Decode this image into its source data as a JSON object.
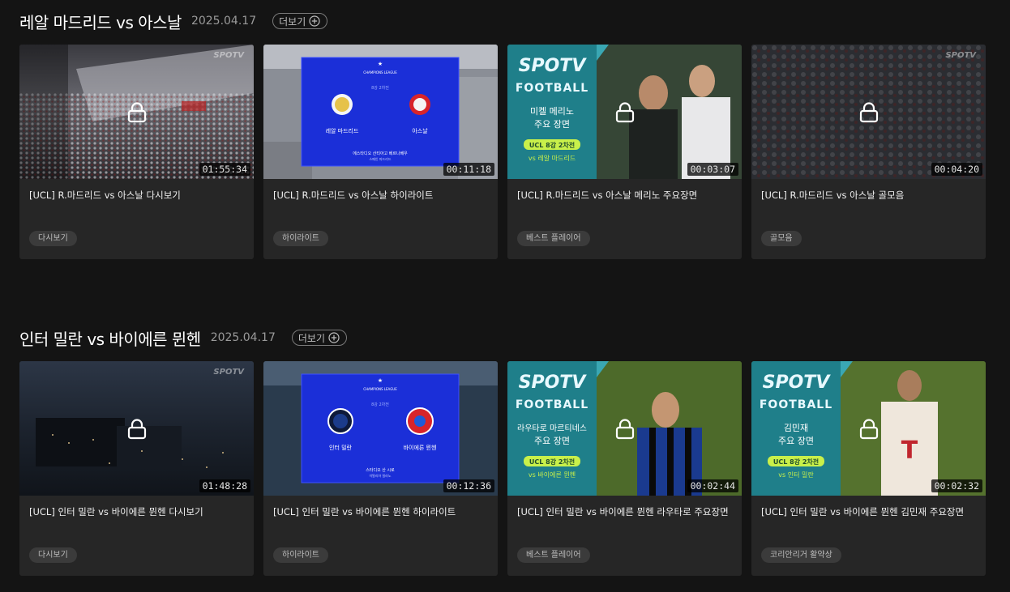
{
  "sections": [
    {
      "title": "레알 마드리드 vs 아스날",
      "date": "2025.04.17",
      "more_label": "더보기",
      "cards": [
        {
          "duration": "01:55:34",
          "title": "[UCL] R.마드리드 vs 아스날 다시보기",
          "tag": "다시보기",
          "watermark": "SPOTV"
        },
        {
          "duration": "00:11:18",
          "title": "[UCL] R.마드리드 vs 아스날 하이라이트",
          "tag": "하이라이트",
          "graphic": {
            "league": "CHAMPIONS LEAGUE",
            "round": "8강 2차전",
            "home": "레알 마드리드",
            "away": "아스날",
            "venue": "에스타디오 산티아고 베르나베우",
            "venue_sub": "스페인 마드리드"
          }
        },
        {
          "duration": "00:03:07",
          "title": "[UCL] R.마드리드 vs 아스날 메리노 주요장면",
          "tag": "베스트 플레이어",
          "promo": {
            "brand_top": "SPOTV",
            "brand_bottom": "FOOTBALL",
            "player": "미켈 메리노",
            "caption": "주요 장면",
            "round": "UCL 8강 2차전",
            "vs": "vs 레알 마드리드"
          }
        },
        {
          "duration": "00:04:20",
          "title": "[UCL] R.마드리드 vs 아스날 골모음",
          "tag": "골모음",
          "watermark": "SPOTV"
        }
      ]
    },
    {
      "title": "인터 밀란 vs 바이에른 뮌헨",
      "date": "2025.04.17",
      "more_label": "더보기",
      "cards": [
        {
          "duration": "01:48:28",
          "title": "[UCL] 인터 밀란 vs 바이에른 뮌헨 다시보기",
          "tag": "다시보기",
          "watermark": "SPOTV"
        },
        {
          "duration": "00:12:36",
          "title": "[UCL] 인터 밀란 vs 바이에른 뮌헨 하이라이트",
          "tag": "하이라이트",
          "graphic": {
            "league": "CHAMPIONS LEAGUE",
            "round": "8강 2차전",
            "home": "인터 밀란",
            "away": "바이에른 뮌헨",
            "venue": "스타디오 산 시로",
            "venue_sub": "이탈리아 밀라노"
          }
        },
        {
          "duration": "00:02:44",
          "title": "[UCL] 인터 밀란 vs 바이에른 뮌헨 라우타로 주요장면",
          "tag": "베스트 플레이어",
          "promo": {
            "brand_top": "SPOTV",
            "brand_bottom": "FOOTBALL",
            "player": "라우타로 마르티네스",
            "caption": "주요 장면",
            "round": "UCL 8강 2차전",
            "vs": "vs 바이에른 뮌헨"
          }
        },
        {
          "duration": "00:02:32",
          "title": "[UCL] 인터 밀란 vs 바이에른 뮌헨 김민재 주요장면",
          "tag": "코리안리거 활약상",
          "promo": {
            "brand_top": "SPOTV",
            "brand_bottom": "FOOTBALL",
            "player": "김민재",
            "caption": "주요 장면",
            "round": "UCL 8강 2차전",
            "vs": "vs 인터 밀란"
          }
        }
      ]
    }
  ],
  "colors": {
    "background": "#141414",
    "card": "#262626",
    "tag": "#3b3b3b",
    "ucl_blue": "#1b2fd8",
    "promo_teal": "#1f7f8a"
  }
}
